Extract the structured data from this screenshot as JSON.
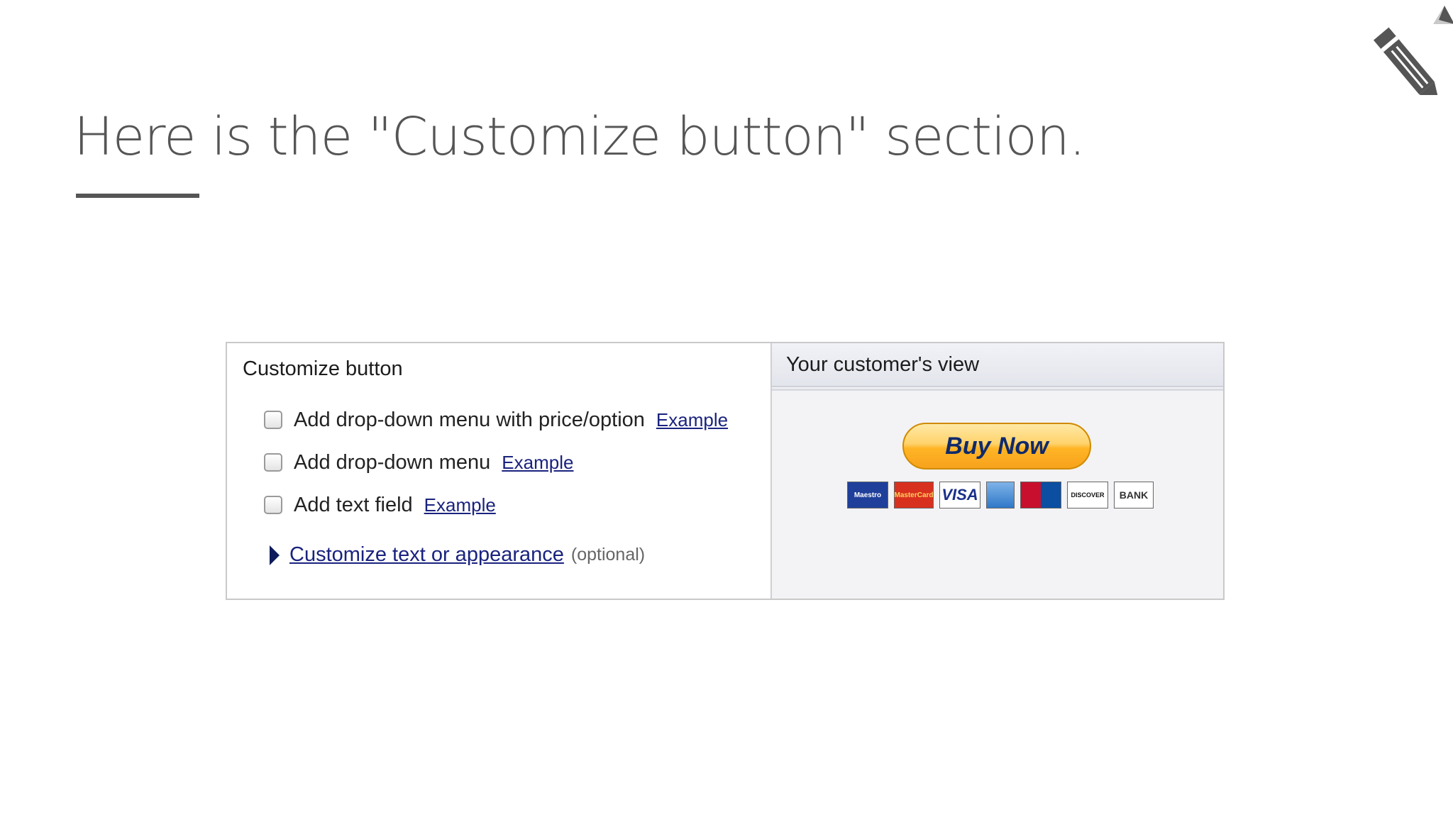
{
  "slide": {
    "title": "Here is the \"Customize button\" section.",
    "corner_icon": "pencil-icon"
  },
  "customize": {
    "heading": "Customize button",
    "options": [
      {
        "label": "Add drop-down menu with price/option",
        "link": "Example",
        "checked": false
      },
      {
        "label": "Add drop-down menu",
        "link": "Example",
        "checked": false
      },
      {
        "label": "Add text field",
        "link": "Example",
        "checked": false
      }
    ],
    "expand_link": "Customize text or appearance",
    "expand_note": "(optional)",
    "expand_icon": "expand-triangle-icon"
  },
  "preview": {
    "heading": "Your customer's view",
    "button_label": "Buy Now",
    "cards": [
      {
        "name": "Maestro",
        "label": "Maestro"
      },
      {
        "name": "MasterCard",
        "label": "MasterCard"
      },
      {
        "name": "Visa",
        "label": "VISA"
      },
      {
        "name": "American Express",
        "label": ""
      },
      {
        "name": "JCB",
        "label": ""
      },
      {
        "name": "Discover",
        "label": "DISCOVER"
      },
      {
        "name": "Bank",
        "label": "BANK"
      }
    ]
  },
  "colors": {
    "title_text": "#555555",
    "link": "#1a237e",
    "buy_button": "#ffb526",
    "preview_bg": "#f3f3f5"
  }
}
